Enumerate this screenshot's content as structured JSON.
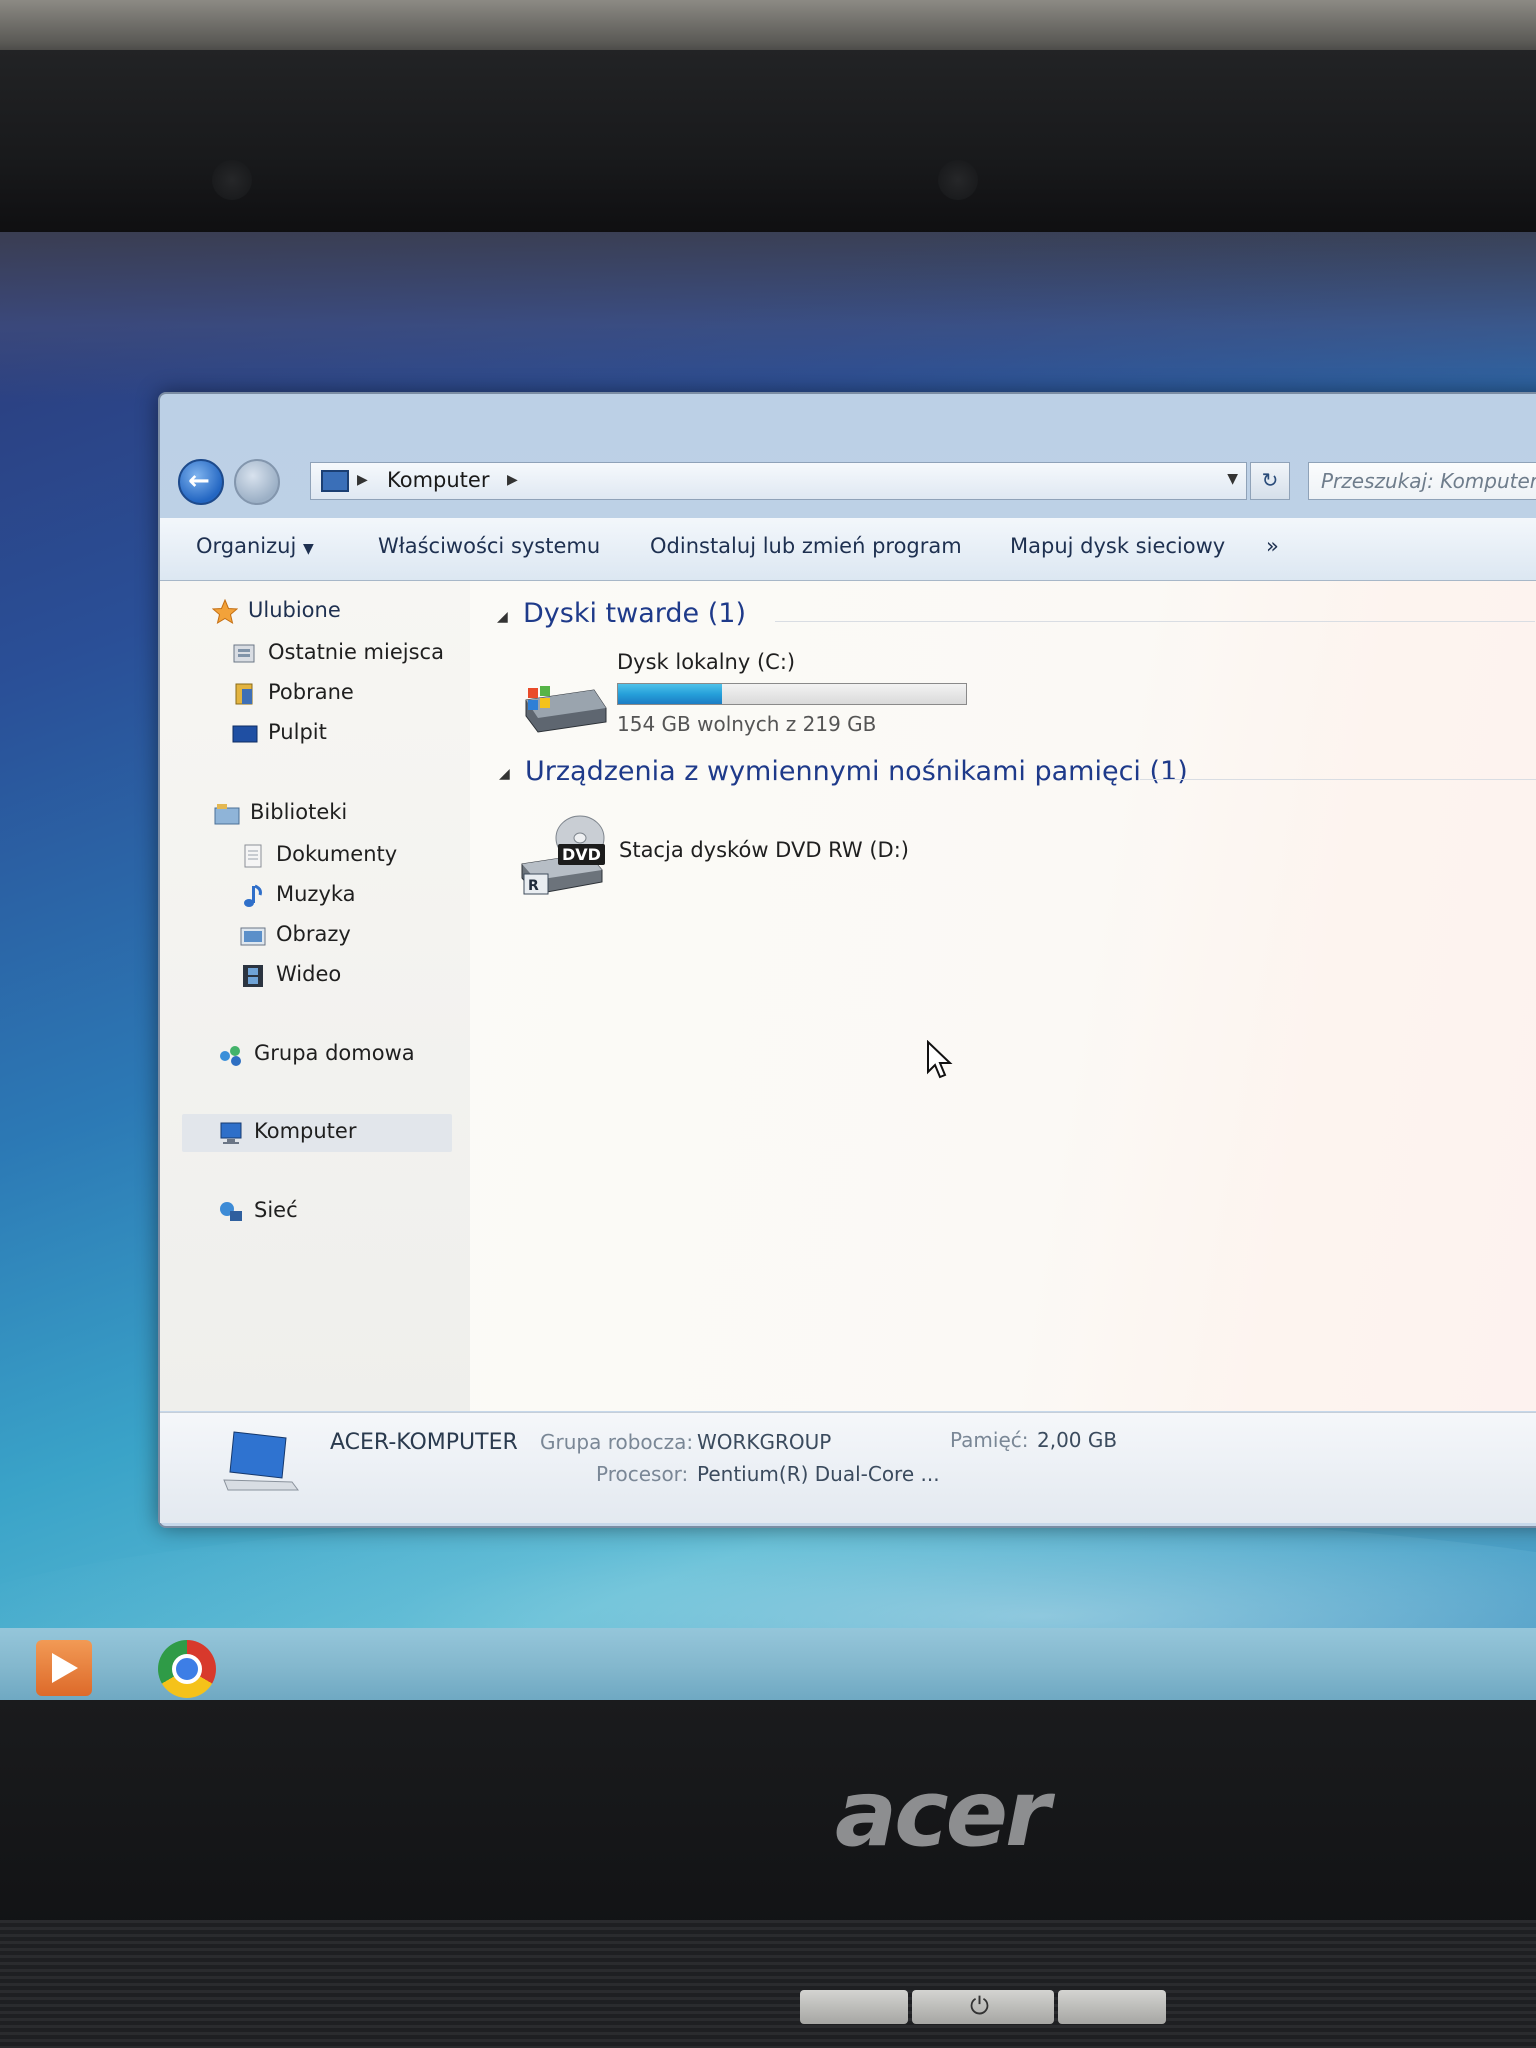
{
  "window": {
    "address": {
      "location": "Komputer"
    },
    "search": {
      "placeholder": "Przeszukaj: Komputer"
    },
    "toolbar": {
      "organize": "Organizuj",
      "system_properties": "Właściwości systemu",
      "uninstall": "Odinstaluj lub zmień program",
      "map_drive": "Mapuj dysk sieciowy",
      "more": "»"
    },
    "sidebar": {
      "favorites": "Ulubione",
      "recent": "Ostatnie miejsca",
      "downloads": "Pobrane",
      "desktop": "Pulpit",
      "libraries": "Biblioteki",
      "documents": "Dokumenty",
      "music": "Muzyka",
      "pictures": "Obrazy",
      "videos": "Wideo",
      "homegroup": "Grupa domowa",
      "computer": "Komputer",
      "network": "Sieć"
    },
    "content": {
      "hard_drives_header": "Dyski twarde (1)",
      "drive_c": {
        "name": "Dysk lokalny (C:)",
        "free_text": "154 GB wolnych z 219 GB",
        "used_fraction": 0.3
      },
      "removable_header": "Urządzenia z wymiennymi nośnikami pamięci (1)",
      "drive_d": {
        "name": "Stacja dysków DVD RW (D:)",
        "badge": "DVD"
      }
    },
    "details": {
      "computer_name": "ACER-KOMPUTER",
      "workgroup_label": "Grupa robocza:",
      "workgroup_value": "WORKGROUP",
      "memory_label": "Pamięć:",
      "memory_value": "2,00 GB",
      "processor_label": "Procesor:",
      "processor_value": "Pentium(R) Dual-Core ..."
    }
  },
  "laptop": {
    "brand": "acer"
  },
  "colors": {
    "accent_blue": "#1e3a8a",
    "bar_fill": "#26a0da",
    "desktop_blue": "#2c79b5"
  }
}
